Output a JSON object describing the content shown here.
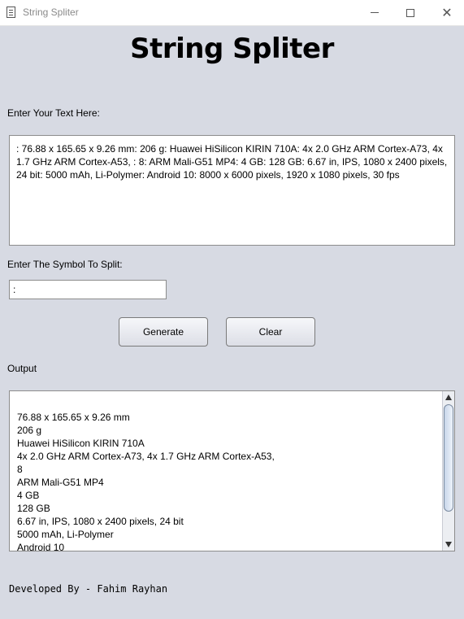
{
  "window": {
    "title": "String Spliter",
    "minimize_icon": "minimize-icon",
    "maximize_icon": "maximize-icon",
    "close_glyph": "✕"
  },
  "heading": "String Spliter",
  "input_label": "Enter Your Text Here:",
  "input_text": ": 76.88 x 165.65 x 9.26 mm: 206 g: Huawei HiSilicon KIRIN 710A: 4x 2.0 GHz ARM Cortex-A73, 4x 1.7 GHz ARM Cortex-A53, : 8: ARM Mali-G51 MP4: 4 GB: 128 GB: 6.67 in, IPS, 1080 x 2400 pixels, 24 bit: 5000 mAh, Li-Polymer: Android 10: 8000 x 6000 pixels, 1920 x 1080 pixels, 30 fps",
  "symbol_label": "Enter The Symbol To Split:",
  "symbol_value": ":",
  "buttons": {
    "generate": "Generate",
    "clear": "Clear"
  },
  "output_label": "Output",
  "output_lines": [
    "76.88 x 165.65 x 9.26 mm",
    "206 g",
    "Huawei HiSilicon KIRIN 710A",
    "4x 2.0 GHz ARM Cortex-A73, 4x 1.7 GHz ARM Cortex-A53,",
    "8",
    "ARM Mali-G51 MP4",
    "4 GB",
    "128 GB",
    "6.67 in, IPS, 1080 x 2400 pixels, 24 bit",
    "5000 mAh, Li-Polymer",
    "Android 10"
  ],
  "footer": "Developed By - Fahim Rayhan"
}
